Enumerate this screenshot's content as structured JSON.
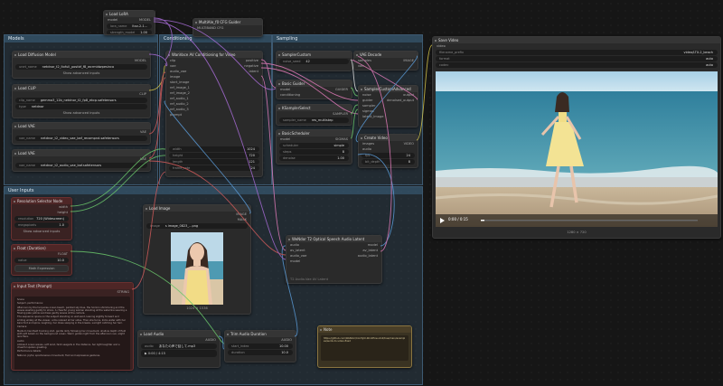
{
  "groups": {
    "models": "Models",
    "conditioning": "Conditioning",
    "sampling": "Sampling",
    "user_inputs": "User Inputs"
  },
  "lora_node": {
    "title": "Load LoRA",
    "model_label": "model",
    "model_out": "MODEL",
    "lora_name_label": "lora_name",
    "lora_name": "ltxv-2-1...",
    "strength_label": "strength_model",
    "strength": "1.00"
  },
  "cfg_node": {
    "title": "MultiAIe_f0 CFG Guider",
    "sub": "MULTIBAND CFG"
  },
  "load_diffusion": {
    "title": "Load Diffusion Model",
    "out": "MODEL",
    "unet_label": "unet_name",
    "unet": "netdnor_t2_ltxfull_postbf_f8_wcrmidwpesinco",
    "adv": "Show advanced inputs"
  },
  "load_clip": {
    "title": "Load CLIP",
    "out": "CLIP",
    "clip_label": "clip_name",
    "clip": "gemma3_12b_netdnor_t2_fp8_ekcp.safetensors",
    "type_label": "type",
    "type": "netdnor",
    "adv": "Show advanced inputs"
  },
  "load_vae": {
    "title": "Load VAE",
    "out": "VAE",
    "vae_label": "vae_name",
    "vae": "netdnor_t2_video_vae_baf_recompnd.safetensors"
  },
  "load_vae2": {
    "title": "Load VAE",
    "out": "VAE",
    "vae_label": "vae_name",
    "vae": "netdnor_t2_audio_vae_baf.safetensors"
  },
  "wan_cond": {
    "title": "WanVace AV Conditioning for Video",
    "inputs": [
      "clip",
      "vae",
      "audio_vae",
      "image",
      "start_image",
      "ref_image_1",
      "ref_image_2",
      "ref_audio_1",
      "ref_audio_2",
      "ref_audio_3",
      "prompt"
    ],
    "outputs": [
      "positive",
      "negative",
      "latent"
    ],
    "params": [
      {
        "k": "width",
        "v": "1024"
      },
      {
        "k": "height",
        "v": "720"
      },
      {
        "k": "length",
        "v": "121"
      },
      {
        "k": "frame_rate",
        "v": "24"
      }
    ]
  },
  "sampler_node": {
    "title": "SamplerCustom",
    "noise_label": "noise_seed",
    "noise": "42",
    "out": "NOISE"
  },
  "basic_guider": {
    "title": "Basic Guider",
    "inputs": [
      "model",
      "conditioning"
    ],
    "out": "GUIDER"
  },
  "ksampler_select": {
    "title": "KSamplerSelect",
    "sampler_label": "sampler_name",
    "sampler": "res_multistep",
    "out": "SAMPLER"
  },
  "basic_scheduler": {
    "title": "BasicScheduler",
    "inputs": [
      "model"
    ],
    "out": "SIGMAS",
    "params": [
      {
        "k": "scheduler",
        "v": "simple"
      },
      {
        "k": "steps",
        "v": "8"
      },
      {
        "k": "denoise",
        "v": "1.00"
      }
    ]
  },
  "vae_decode": {
    "title": "VAE Decode",
    "inputs": [
      "samples",
      "vae"
    ],
    "out": "IMAGE"
  },
  "sampler_custom_adv": {
    "title": "SamplerCustomAdvanced",
    "inputs": [
      "noise",
      "guider",
      "sampler",
      "sigmas",
      "latent_image"
    ],
    "outputs": [
      "output",
      "denoised_output"
    ]
  },
  "create_video": {
    "title": "Create Video",
    "inputs": [
      "images",
      "audio"
    ],
    "out": "VIDEO",
    "params": [
      {
        "k": "fps",
        "v": "24"
      },
      {
        "k": "bit_depth",
        "v": "8"
      }
    ]
  },
  "save_video": {
    "title": "Save Video",
    "input": "video",
    "params": [
      {
        "k": "filename_prefix",
        "v": "video/LTX-2_beach"
      },
      {
        "k": "format",
        "v": "auto"
      },
      {
        "k": "codec",
        "v": "auto"
      }
    ],
    "time": "0:00 / 0:15",
    "resolution": "1280 × 720"
  },
  "res_selector": {
    "title": "Resolution Selector Node",
    "outputs": [
      "width",
      "height"
    ],
    "params": [
      {
        "k": "resolution",
        "v": "720 (Widescreen)"
      },
      {
        "k": "megapixels",
        "v": "1.0"
      }
    ],
    "adv": "Show advanced inputs"
  },
  "float_node": {
    "title": "Float (Duration)",
    "out": "FLOAT",
    "val_label": "value",
    "val": "10.0",
    "math": "Math Expression"
  },
  "load_image": {
    "title": "Load Image",
    "outputs": [
      "IMAGE",
      "MASK"
    ],
    "image_label": "image",
    "image": "s image_0823_...png",
    "dims": "1024 × 1536"
  },
  "prompt_node": {
    "title": "Input Text (Prompt)",
    "out": "STRING",
    "text": [
      "Scene",
      "Subject, performance:",
      "Afternoon by the turquoise ocean beach, painted sky blue, the horizon shimmering and the waves washing gently to shore. A cheerful young woman standing at the waterline wearing a flowing pale yellow sundress gently waves at the camera.",
      "The sequence opens on the subject standing on wet sand, leaning slightly forward and smiling widely at the viewer, arms relaxed at her sides. Then she turns, kicks water with her bare foot and spins, laughing, her dress swaying in the breeze, sunlight catching her hair.",
      "Camera:",
      "Medium handheld tracking shot, gentle dolly following her movement, shallow depth of field with soft bokeh on the background ocean. Warm golden light from the afternoon sun, slight lens flare.",
      "Audio:",
      "Ambient ocean waves, soft wind, faint seagulls in the distance, her light laughter and a cheerful spoken greeting.",
      "Performance details:",
      "Natural, joyful, spontaneous movement, fluid and expressive gestures."
    ]
  },
  "load_audio": {
    "title": "Load Audio",
    "out": "AUDIO",
    "audio_label": "audio",
    "audio": "あなたの声で話して.mp3",
    "time": "0:00 / 4:15"
  },
  "trim_audio": {
    "title": "Trim Audio Duration",
    "out": "AUDIO",
    "params": [
      {
        "k": "start_index",
        "v": "10.00"
      },
      {
        "k": "duration",
        "v": "10.0"
      }
    ]
  },
  "av_sep": {
    "title": "WeNdor T2 Optical Speech Audio Latent",
    "inputs": [
      "audio",
      "av_latent",
      "audio_vae",
      "model"
    ],
    "outputs": [
      "model",
      "av_latent",
      "audio_latent"
    ],
    "foot": "T2 Audio-Vae AV Latent"
  },
  "note_node": {
    "title": "Note",
    "text": "https://github.com/WeNdor/ComfyUI-Workflow-Ltx2/tree/main/examples/audio-to-video-fixed"
  },
  "colors": {
    "accent": "#5a87a8",
    "link_purple": "#a66bd4",
    "link_yellow": "#d6c64a",
    "link_red": "#d05a5a",
    "link_green": "#6ac46a",
    "link_blue": "#5a9ad6",
    "link_pink": "#e07ab8"
  }
}
